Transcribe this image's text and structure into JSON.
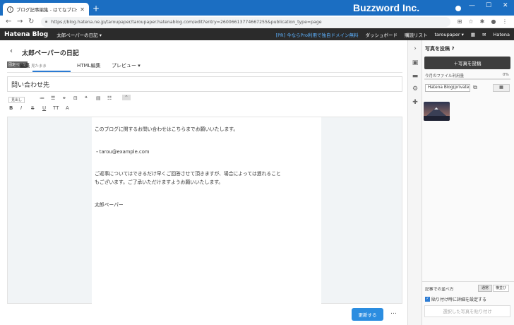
{
  "browser": {
    "tab_title": "ブログ記事編集 - はてなブログ",
    "new_tab": "+",
    "brand": "Buzzword Inc.",
    "url": "https://blog.hatena.ne.jp/taroupaper/taroupaper.hatenablog.com/edit?entry=26006613774667255&publication_type=page",
    "min": "—",
    "max": "☐",
    "close": "✕"
  },
  "hatena_nav": {
    "logo": "Hatena Blog",
    "blog_name": "太郎ペーパーの日記 ▾",
    "pro_promo": "[PR] 今ならPro利用で独自ドメイン無料",
    "dashboard": "ダッシュボード",
    "reading_list": "購読リスト",
    "user": "taroupaper ▾",
    "hatena": "Hatena"
  },
  "editor": {
    "blog_title": "太郎ペーパーの日記",
    "fixed_page_badge": "固定ページ",
    "tab_edit": "編集",
    "tab_edit_sub": "見たまま",
    "tab_html": "HTML編集",
    "tab_preview": "プレビュー ▾",
    "title_value": "問い合わせ先",
    "heading_select": "見出し",
    "body_lines": [
      "このブログに関するお問い合わせはこちらまでお願いいたします。",
      "・tarou@example.com",
      "ご返事についてはできるだけ早くご回答させて頂きますが、場合によっては遅れること",
      "もございます。ご了承いただけますようお願いいたします。",
      "太郎ペーパー"
    ],
    "update_button": "更新する",
    "more": "…"
  },
  "photo_panel": {
    "title": "写真を投稿",
    "upload_button": "＋写真を投稿",
    "usage_label": "今月のファイル利用量",
    "usage_pct": "0%",
    "usage_fraction": 0,
    "album": "Hatena Blog(private) ▾",
    "sort_label": "記事での並べ方",
    "sort_normal": "通常",
    "sort_side": "横並び",
    "checkbox_label": "貼り付け時に詳細を設定する",
    "paste_button": "選択した写真を貼り付け"
  },
  "colors": {
    "chrome_blue": "#1b6ec2",
    "hatena_dark": "#2b2b2b",
    "accent_blue": "#2b8de0"
  }
}
